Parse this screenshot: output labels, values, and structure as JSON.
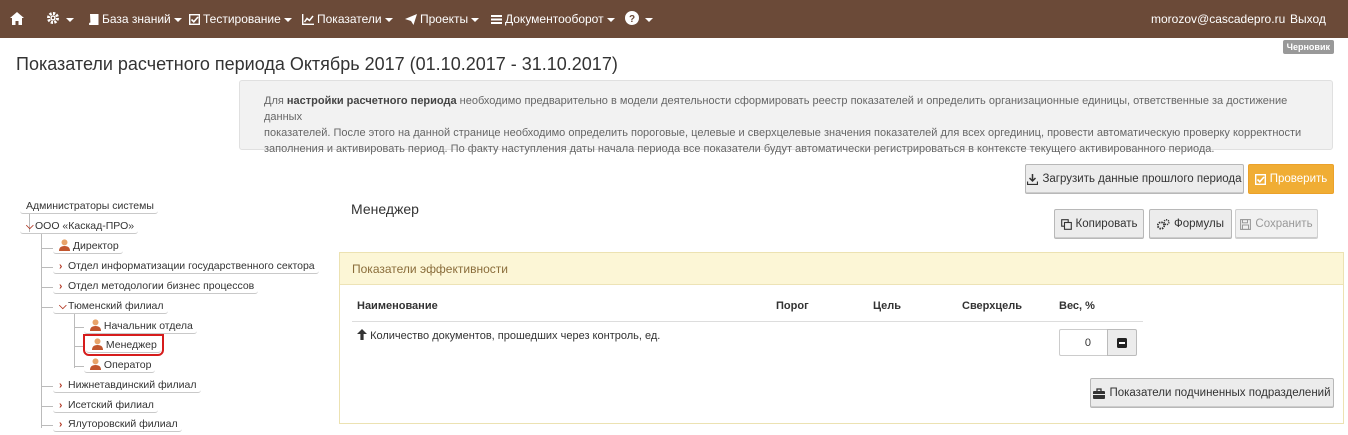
{
  "navbar": {
    "items": [
      {
        "label": "База знаний",
        "icon": "book-icon"
      },
      {
        "label": "Тестирование",
        "icon": "checkbox-icon"
      },
      {
        "label": "Показатели",
        "icon": "line-chart-icon"
      },
      {
        "label": "Проекты",
        "icon": "paper-plane-icon"
      },
      {
        "label": "Документооборот",
        "icon": "list-icon"
      }
    ],
    "user_email": "morozov@cascadepro.ru",
    "logout": "Выход"
  },
  "badge": "Черновик",
  "page_title": "Показатели расчетного периода Октябрь 2017 (01.10.2017 - 31.10.2017)",
  "info": {
    "prefix": "Для ",
    "bold": "настройки расчетного периода",
    "line1_rest": " необходимо предварительно в модели деятельности сформировать реестр показателей и определить организационные единицы, ответственные за достижение данных",
    "line2": "показателей. После этого на данной странице необходимо определить пороговые, целевые и сверхцелевые значения показателей для всех оргединиц, провести автоматическую проверку корректности",
    "line3": "заполнения и активировать период. По факту наступления даты начала периода все показатели будут автоматически регистрироваться в контексте текущего активированного периода."
  },
  "actions": {
    "load_prev": "Загрузить данные прошлого периода",
    "check": "Проверить",
    "copy": "Копировать",
    "formulas": "Формулы",
    "save": "Сохранить",
    "subordinate": "Показатели подчиненных подразделений"
  },
  "tree": {
    "admins": "Администраторы системы",
    "org": "ООО «Каскад-ПРО»",
    "director": "Директор",
    "dept1": "Отдел информатизации государственного сектора",
    "dept2": "Отдел методологии бизнес процессов",
    "tyumen": "Тюменский филиал",
    "head": "Начальник отдела",
    "manager": "Менеджер",
    "operator": "Оператор",
    "nizhne": "Нижнетавдинский филиал",
    "iset": "Исетский филиал",
    "yalut": "Ялуторовский филиал"
  },
  "section_title": "Менеджер",
  "panel": {
    "title": "Показатели эффективности",
    "columns": [
      "Наименование",
      "Порог",
      "Цель",
      "Сверхцель",
      "Вес, %"
    ],
    "rows": [
      {
        "name": "Количество документов, прошедших через контроль, ед.",
        "weight": "0"
      }
    ]
  }
}
